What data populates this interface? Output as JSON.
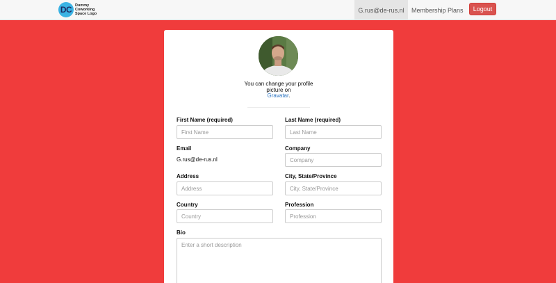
{
  "navbar": {
    "logo_initials": "DC",
    "logo_text": "Dummy Coworking Space Logo",
    "user_email": "G.rus@de-rus.nl",
    "membership_label": "Membership Plans",
    "logout_label": "Logout"
  },
  "profile": {
    "avatar_note_before": "You can change your profile picture on",
    "avatar_link": "Gravatar",
    "avatar_note_after": ".",
    "first_name_label": "First Name (required)",
    "first_name_placeholder": "First Name",
    "last_name_label": "Last Name (required)",
    "last_name_placeholder": "Last Name",
    "email_label": "Email",
    "email_value": "G.rus@de-rus.nl",
    "company_label": "Company",
    "company_placeholder": "Company",
    "address_label": "Address",
    "address_placeholder": "Address",
    "city_label": "City, State/Province",
    "city_placeholder": "City, State/Province",
    "country_label": "Country",
    "country_placeholder": "Country",
    "profession_label": "Profession",
    "profession_placeholder": "Profession",
    "bio_label": "Bio",
    "bio_placeholder": "Enter a short description"
  },
  "colors": {
    "background": "#f03c3c",
    "logout_button": "#d9534f",
    "link": "#2a73c0"
  }
}
